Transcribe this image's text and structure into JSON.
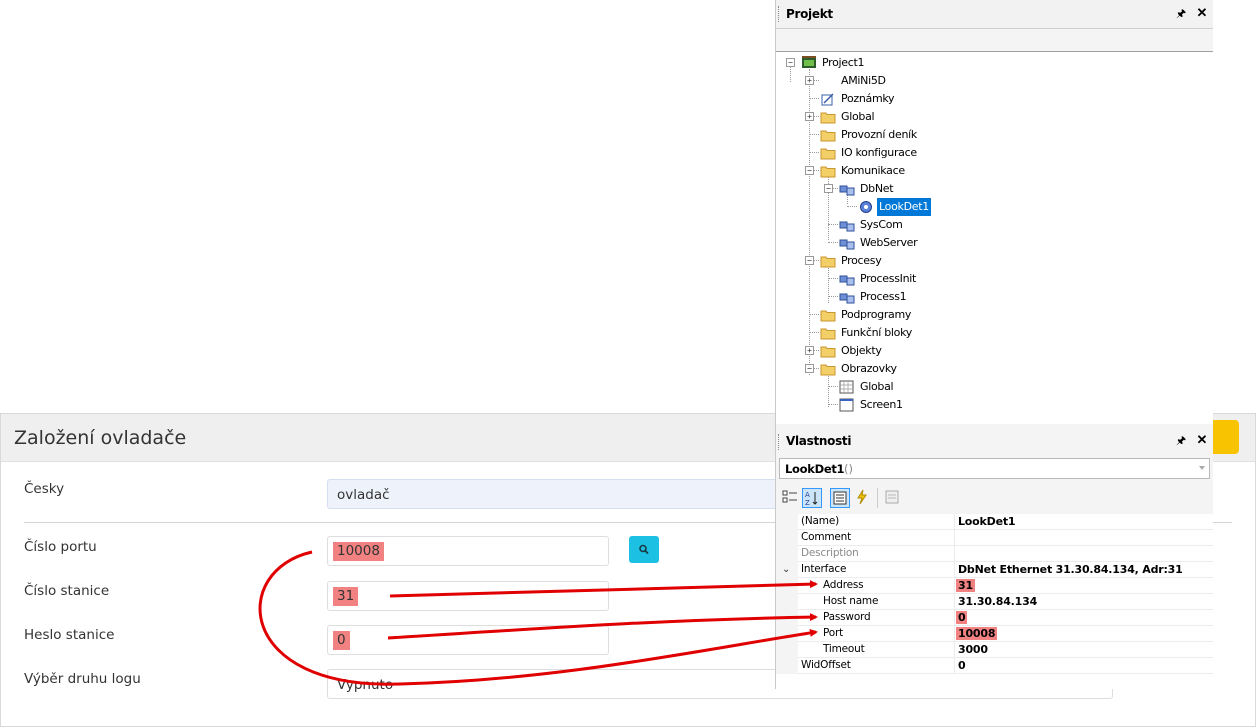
{
  "form": {
    "title": "Založení ovladače",
    "fields": {
      "language_label": "Česky",
      "language_value": "ovladač",
      "port_label": "Číslo portu",
      "port_value": "10008",
      "station_label": "Číslo stanice",
      "station_value": "31",
      "password_label": "Heslo stanice",
      "password_value": "0",
      "log_label": "Výběr druhu logu",
      "log_value": "Vypnuto"
    },
    "colors": {
      "highlight": "#f28282",
      "search_button": "#1bc0e3",
      "action_button": "#f8c300"
    }
  },
  "project": {
    "title": "Projekt",
    "tree": [
      {
        "label": "Project1",
        "icon": "project-icon"
      },
      {
        "label": "AMiNi5D",
        "icon": "device-icon"
      },
      {
        "label": "Poznámky",
        "icon": "notes-icon"
      },
      {
        "label": "Global",
        "icon": "folder-icon"
      },
      {
        "label": "Provozní deník",
        "icon": "folder-icon"
      },
      {
        "label": "IO konfigurace",
        "icon": "folder-icon"
      },
      {
        "label": "Komunikace",
        "icon": "folder-icon"
      },
      {
        "label": "DbNet",
        "icon": "network-icon"
      },
      {
        "label": "LookDet1",
        "icon": "gear-icon"
      },
      {
        "label": "SysCom",
        "icon": "network-icon"
      },
      {
        "label": "WebServer",
        "icon": "network-icon"
      },
      {
        "label": "Procesy",
        "icon": "folder-icon"
      },
      {
        "label": "ProcessInit",
        "icon": "process-icon"
      },
      {
        "label": "Process1",
        "icon": "process-icon"
      },
      {
        "label": "Podprogramy",
        "icon": "folder-icon"
      },
      {
        "label": "Funkční bloky",
        "icon": "folder-icon"
      },
      {
        "label": "Objekty",
        "icon": "folder-icon"
      },
      {
        "label": "Obrazovky",
        "icon": "folder-icon"
      },
      {
        "label": "Global",
        "icon": "screen-grid-icon"
      },
      {
        "label": "Screen1",
        "icon": "screen-icon"
      }
    ]
  },
  "properties": {
    "title": "Vlastnosti",
    "object_name": "LookDet1",
    "object_type": "()",
    "rows": [
      {
        "name": "(Name)",
        "value": "LookDet1"
      },
      {
        "name": "Comment",
        "value": ""
      },
      {
        "name": "Description",
        "value": ""
      },
      {
        "name": "Interface",
        "value": "DbNet Ethernet 31.30.84.134, Adr:31"
      },
      {
        "name": "Address",
        "value": "31"
      },
      {
        "name": "Host name",
        "value": "31.30.84.134"
      },
      {
        "name": "Password",
        "value": "0"
      },
      {
        "name": "Port",
        "value": "10008"
      },
      {
        "name": "Timeout",
        "value": "3000"
      },
      {
        "name": "WidOffset",
        "value": "0"
      }
    ]
  }
}
